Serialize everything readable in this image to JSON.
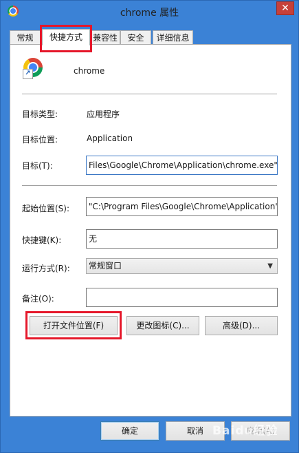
{
  "window": {
    "title": "chrome 属性",
    "close_label": "✕"
  },
  "tabs": [
    {
      "label": "常规"
    },
    {
      "label": "快捷方式"
    },
    {
      "label": "兼容性"
    },
    {
      "label": "安全"
    },
    {
      "label": "详细信息"
    }
  ],
  "shortcut": {
    "name": "chrome",
    "target_type_label": "目标类型:",
    "target_type_value": "应用程序",
    "target_location_label": "目标位置:",
    "target_location_value": "Application",
    "target_label": "目标(T):",
    "target_value": "Files\\Google\\Chrome\\Application\\chrome.exe\"",
    "start_in_label": "起始位置(S):",
    "start_in_value": "\"C:\\Program Files\\Google\\Chrome\\Application\"",
    "hotkey_label": "快捷键(K):",
    "hotkey_value": "无",
    "run_label": "运行方式(R):",
    "run_value": "常规窗口",
    "comment_label": "备注(O):",
    "comment_value": ""
  },
  "buttons": {
    "open_location": "打开文件位置(F)",
    "change_icon": "更改图标(C)...",
    "advanced": "高级(D)...",
    "ok": "确定",
    "cancel": "取消",
    "apply": "应用(A)"
  },
  "watermark": "Baidu经验",
  "colors": {
    "highlight": "#e5172a",
    "titlebar": "#3b82d6",
    "close": "#c7403a"
  }
}
